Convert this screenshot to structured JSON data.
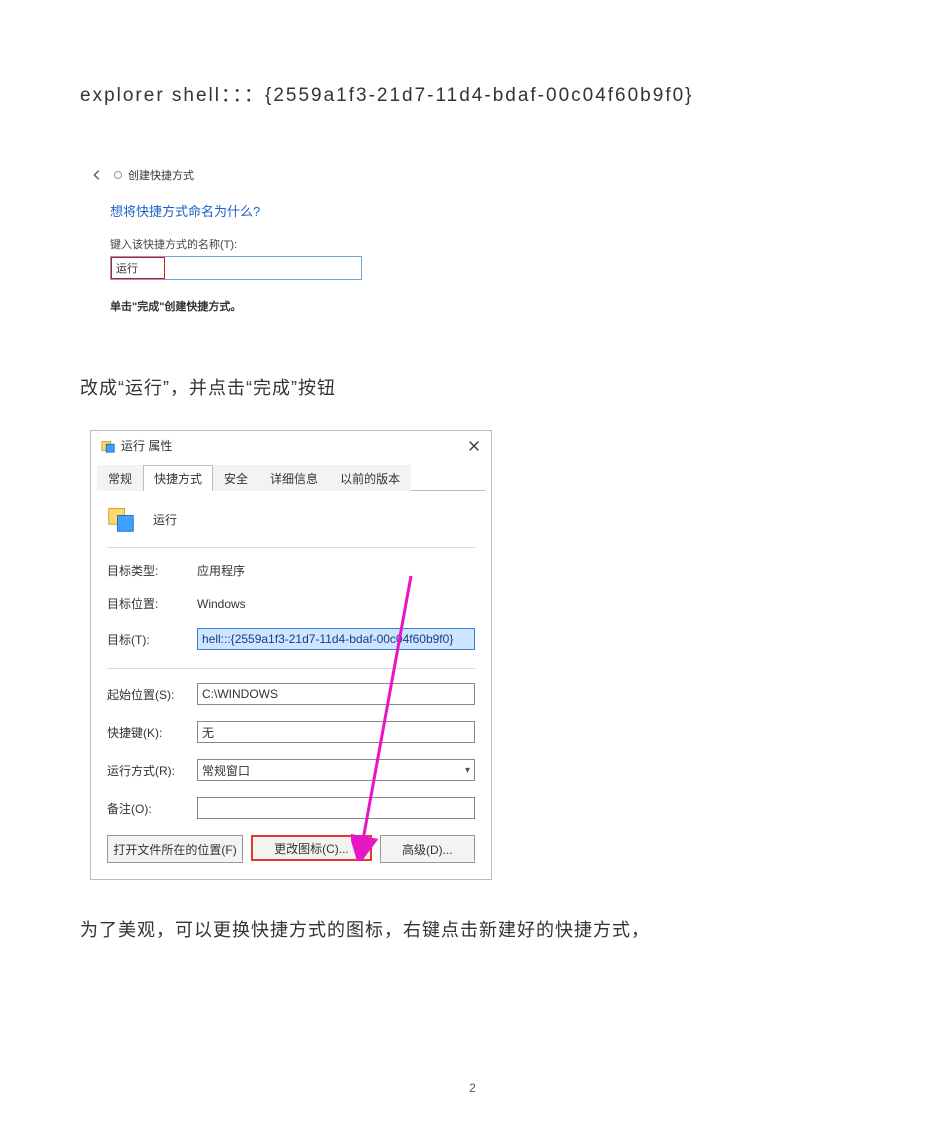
{
  "doc": {
    "line_command": "explorer shell：：：{2559a1f3-21d7-11d4-bdaf-00c04f60b9f0}",
    "para1": "改成“运行”，并点击“完成”按钮",
    "para2": "为了美观，可以更换快捷方式的图标，右键点击新建好的快捷方式，",
    "page_number": "2"
  },
  "create_shortcut": {
    "breadcrumb": "创建快捷方式",
    "question": "想将快捷方式命名为什么?",
    "name_label": "键入该快捷方式的名称(T):",
    "name_value": "运行",
    "finish_hint": "单击\"完成\"创建快捷方式。"
  },
  "properties": {
    "window_title": "运行 属性",
    "tabs": {
      "general": "常规",
      "shortcut": "快捷方式",
      "security": "安全",
      "details": "详细信息",
      "previous": "以前的版本"
    },
    "icon_name": "运行",
    "fields": {
      "target_type_label": "目标类型:",
      "target_type_value": "应用程序",
      "target_location_label": "目标位置:",
      "target_location_value": "Windows",
      "target_label": "目标(T):",
      "target_value": "hell:::{2559a1f3-21d7-11d4-bdaf-00c04f60b9f0}",
      "startin_label": "起始位置(S):",
      "startin_value": "C:\\WINDOWS",
      "hotkey_label": "快捷键(K):",
      "hotkey_value": "无",
      "run_label": "运行方式(R):",
      "run_value": "常规窗口",
      "comment_label": "备注(O):",
      "comment_value": ""
    },
    "buttons": {
      "open_location": "打开文件所在的位置(F)",
      "change_icon": "更改图标(C)...",
      "advanced": "高级(D)..."
    }
  }
}
